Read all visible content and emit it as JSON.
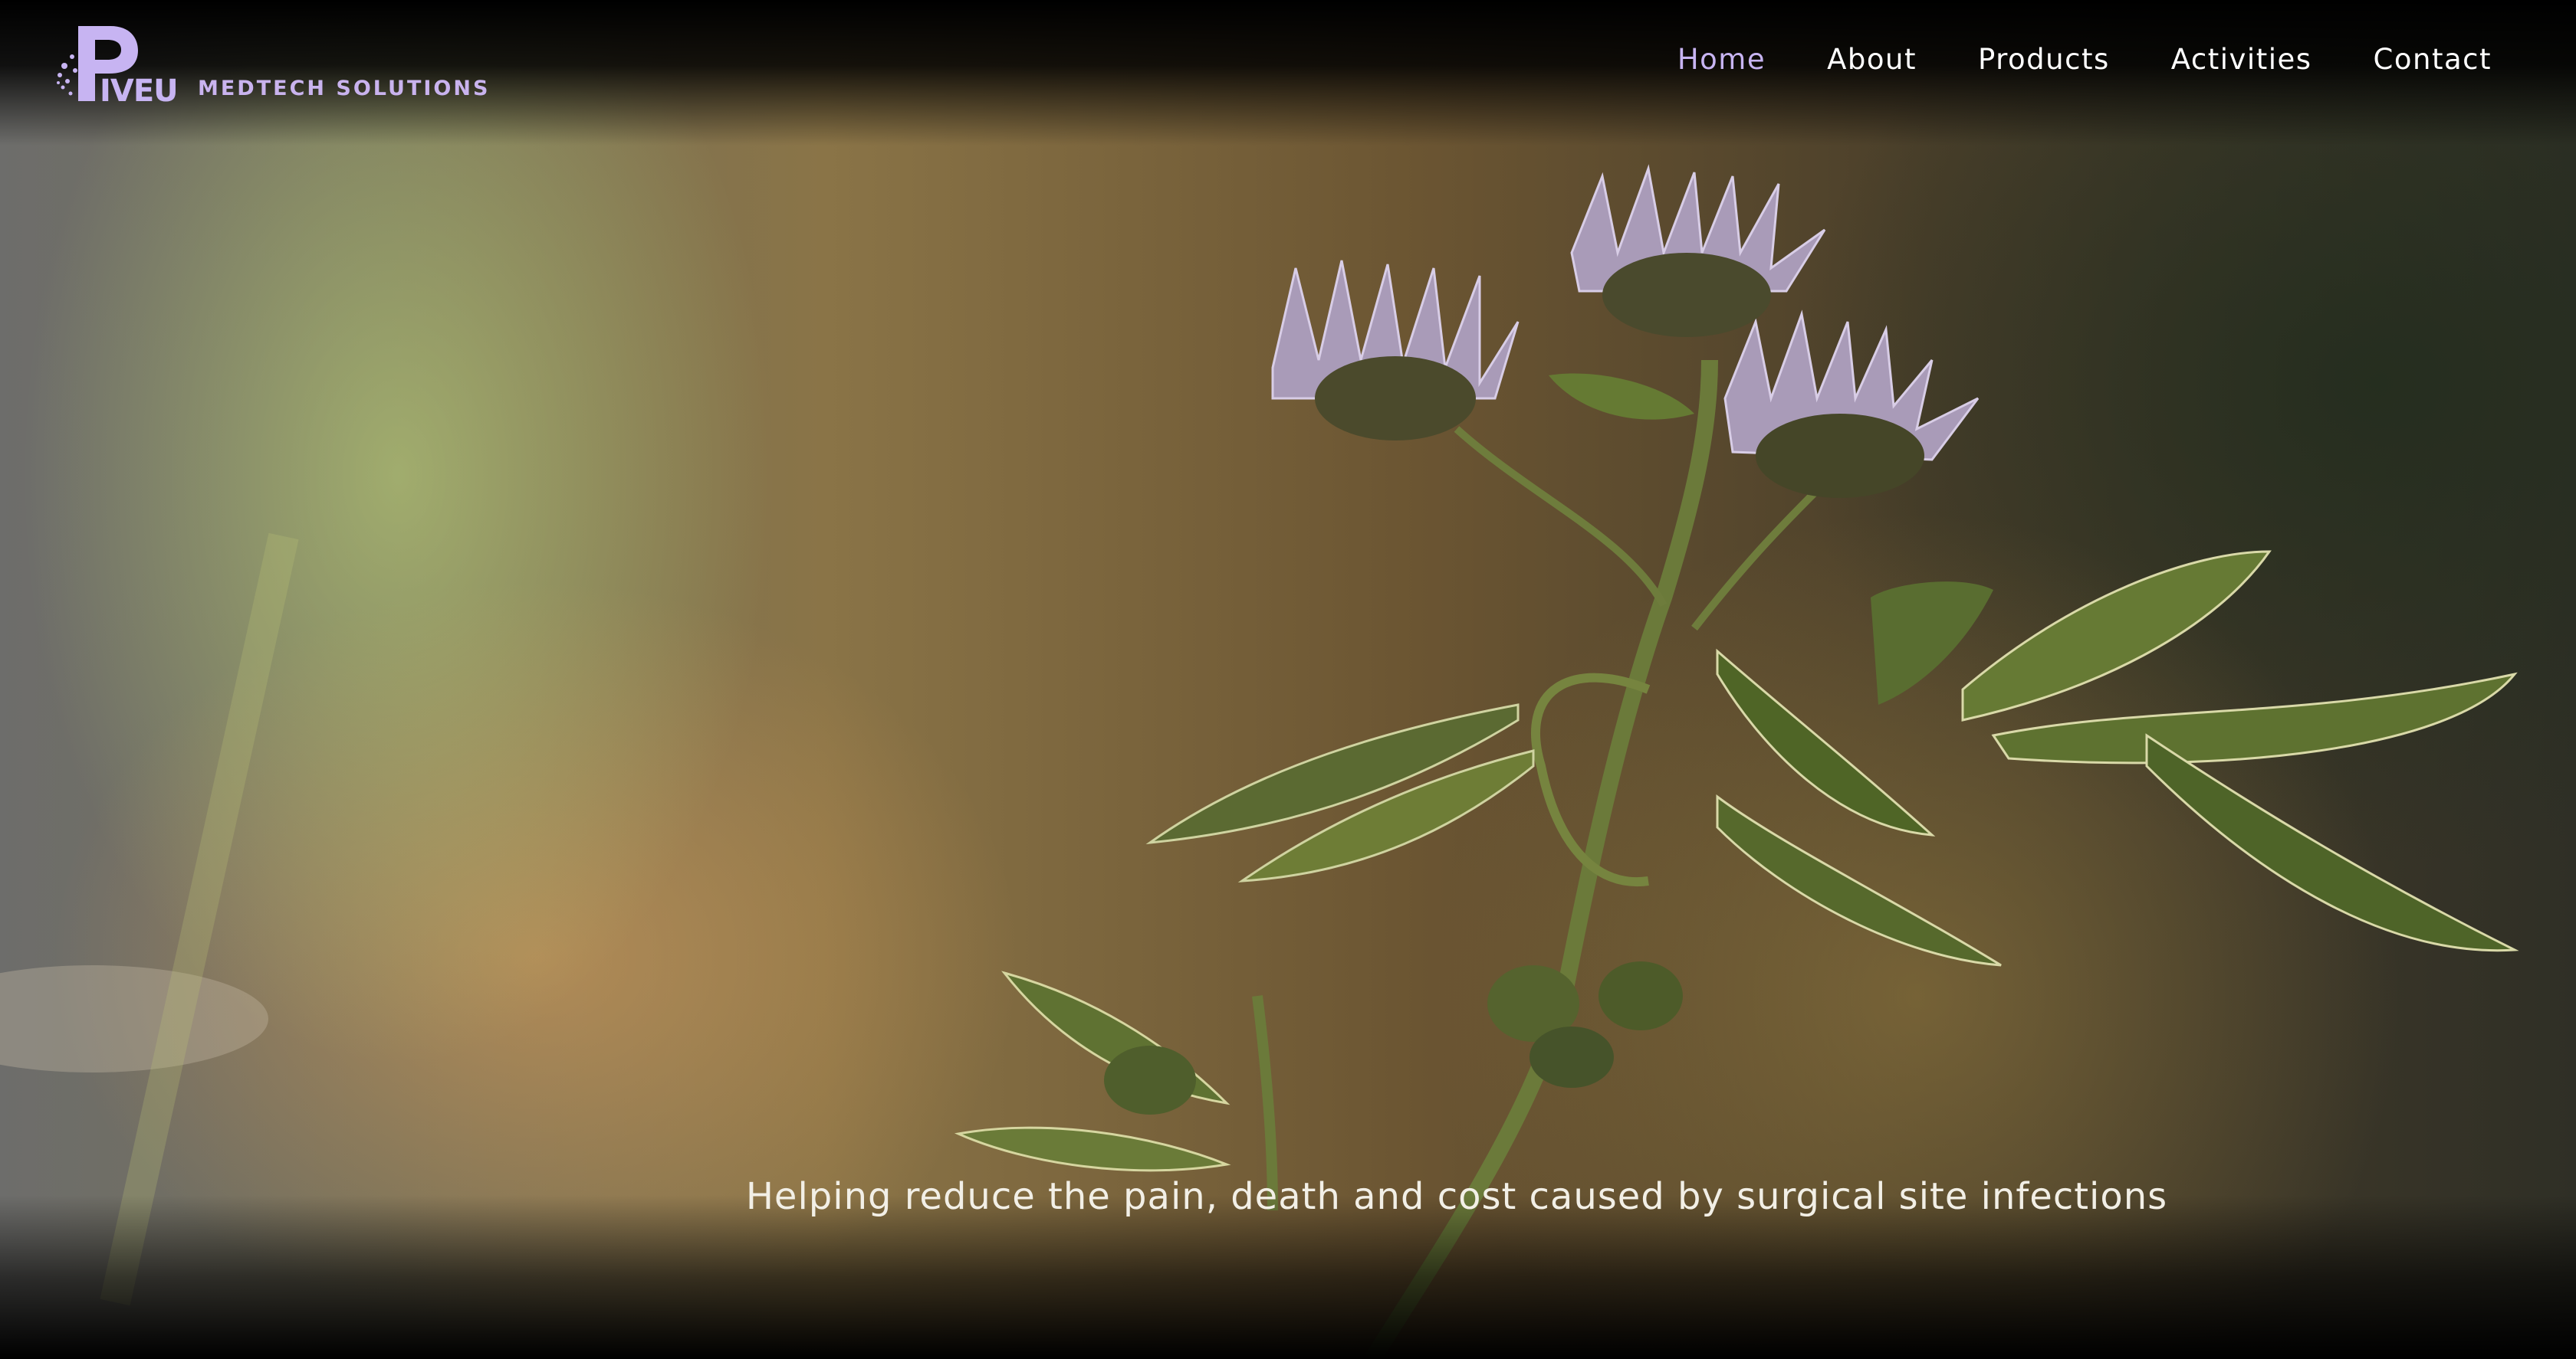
{
  "brand": {
    "logo_icon": "piveu-logo-icon",
    "logo_text": "PIVEU",
    "subtitle": "MEDTECH SOLUTIONS",
    "accent_color": "#c7b4f2"
  },
  "nav": {
    "items": [
      {
        "label": "Home",
        "active": true
      },
      {
        "label": "About",
        "active": false
      },
      {
        "label": "Products",
        "active": false
      },
      {
        "label": "Activities",
        "active": false
      },
      {
        "label": "Contact",
        "active": false
      }
    ]
  },
  "hero": {
    "background_image": "wildflower-sunlight-photo",
    "tagline": "Helping reduce the pain, death and cost caused by surgical site infections"
  }
}
